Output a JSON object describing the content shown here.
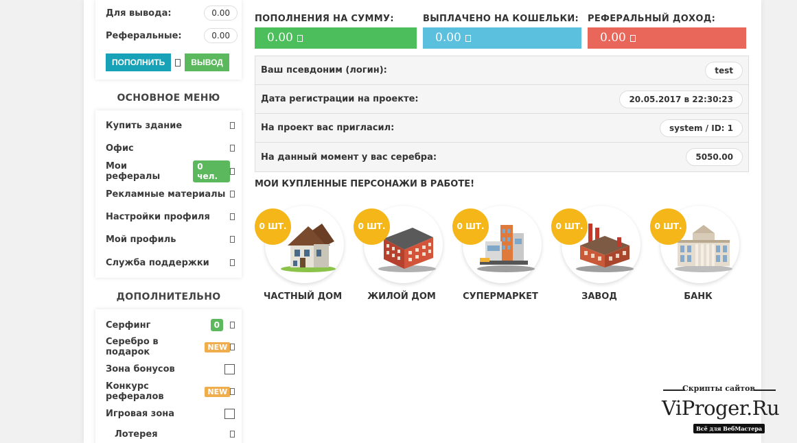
{
  "balance": {
    "withdraw_label": "Для вывода:",
    "withdraw_value": "0.00",
    "referral_label": "Реферальные:",
    "referral_value": "0.00",
    "topup_button": "ПОПОЛНИТЬ",
    "withdraw_button": "ВЫВОД"
  },
  "main_menu": {
    "title": "ОСНОВНОЕ МЕНЮ",
    "items": [
      {
        "label": "Купить здание"
      },
      {
        "label": "Офис"
      },
      {
        "label": "Мои рефералы",
        "badge": "0 чел."
      },
      {
        "label": "Рекламные материалы"
      },
      {
        "label": "Настройки профиля"
      },
      {
        "label": "Мой профиль"
      },
      {
        "label": "Служба поддержки"
      }
    ]
  },
  "extra_menu": {
    "title": "ДОПОЛНИТЕЛЬНО",
    "items": [
      {
        "label": "Серфинг",
        "badge": "0"
      },
      {
        "label": "Серебро в подарок",
        "badge": "NEW"
      },
      {
        "label": "Зона бонусов"
      },
      {
        "label": "Конкурс рефералов",
        "badge": "NEW"
      },
      {
        "label": "Игровая зона"
      },
      {
        "label": "Лотерея"
      }
    ]
  },
  "stats": {
    "deposits_label": "ПОПОЛНЕНИЯ НА СУММУ:",
    "deposits_value": "0.00",
    "paid_label": "ВЫПЛАЧЕНО НА КОШЕЛЬКИ:",
    "paid_value": "0.00",
    "referral_label": "РЕФЕРАЛЬНЫЙ ДОХОД:",
    "referral_value": "0.00",
    "colors": {
      "deposits": "#4cbe5c",
      "paid": "#5bc0de",
      "referral": "#e8675a"
    }
  },
  "profile": [
    {
      "label": "Ваш псевдоним (логин):",
      "value": "test"
    },
    {
      "label": "Дата регистрации на проекте:",
      "value": "20.05.2017 в 22:30:23"
    },
    {
      "label": "На проект вас пригласил:",
      "value": "system / ID: 1"
    },
    {
      "label": "На данный момент у вас серебра:",
      "value": "5050.00"
    }
  ],
  "characters": {
    "title": "МОИ КУПЛЕННЫЕ ПЕРСОНАЖИ В РАБОТЕ!",
    "items": [
      {
        "name": "ЧАСТНЫЙ ДОМ",
        "count": "0 ШТ."
      },
      {
        "name": "ЖИЛОЙ ДОМ",
        "count": "0 ШТ."
      },
      {
        "name": "СУПЕРМАРКЕТ",
        "count": "0 ШТ."
      },
      {
        "name": "ЗАВОД",
        "count": "0 ШТ."
      },
      {
        "name": "БАНК",
        "count": "0 ШТ."
      }
    ]
  },
  "watermark": {
    "top": "Скрипты сайтов",
    "main": "ViProger.Ru",
    "sub": "Всё для ВебМастера"
  }
}
